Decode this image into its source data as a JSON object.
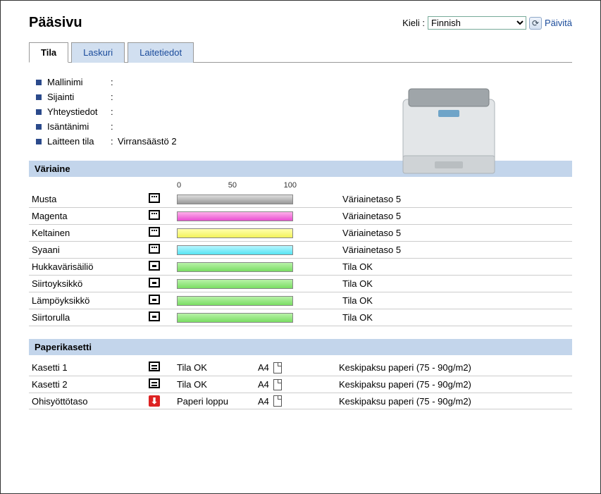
{
  "header": {
    "title": "Pääsivu",
    "lang_label": "Kieli",
    "lang_value": "Finnish",
    "refresh_label": "Päivitä"
  },
  "tabs": {
    "status": "Tila",
    "counter": "Laskuri",
    "device_info": "Laitetiedot"
  },
  "info": {
    "model_name_label": "Mallinimi",
    "model_name_value": "",
    "location_label": "Sijainti",
    "location_value": "",
    "contact_label": "Yhteystiedot",
    "contact_value": "",
    "host_name_label": "Isäntänimi",
    "host_name_value": "",
    "device_status_label": "Laitteen tila",
    "device_status_value": "Virransäästö 2"
  },
  "toner_section": {
    "title": "Väriaine",
    "scale": {
      "s0": "0",
      "s50": "50",
      "s100": "100"
    },
    "rows": [
      {
        "name": "Musta",
        "bar_class": "bar-black",
        "icon": "toner",
        "status": "Väriainetaso 5"
      },
      {
        "name": "Magenta",
        "bar_class": "bar-magenta",
        "icon": "toner",
        "status": "Väriainetaso 5"
      },
      {
        "name": "Keltainen",
        "bar_class": "bar-yellow",
        "icon": "toner",
        "status": "Väriainetaso 5"
      },
      {
        "name": "Syaani",
        "bar_class": "bar-cyan",
        "icon": "toner",
        "status": "Väriainetaso 5"
      },
      {
        "name": "Hukkavärisäiliö",
        "bar_class": "bar-green",
        "icon": "box",
        "status": "Tila OK"
      },
      {
        "name": "Siirtoyksikkö",
        "bar_class": "bar-green",
        "icon": "box",
        "status": "Tila OK"
      },
      {
        "name": "Lämpöyksikkö",
        "bar_class": "bar-green",
        "icon": "box",
        "status": "Tila OK"
      },
      {
        "name": "Siirtorulla",
        "bar_class": "bar-green",
        "icon": "box",
        "status": "Tila OK"
      }
    ]
  },
  "paper_section": {
    "title": "Paperikasetti",
    "rows": [
      {
        "name": "Kasetti 1",
        "icon": "tray",
        "status": "Tila OK",
        "size": "A4",
        "type": "Keskipaksu paperi (75 - 90g/m2)"
      },
      {
        "name": "Kasetti 2",
        "icon": "tray",
        "status": "Tila OK",
        "size": "A4",
        "type": "Keskipaksu paperi (75 - 90g/m2)"
      },
      {
        "name": "Ohisyöttötaso",
        "icon": "tray-empty",
        "status": "Paperi loppu",
        "size": "A4",
        "type": "Keskipaksu paperi (75 - 90g/m2)"
      }
    ]
  }
}
